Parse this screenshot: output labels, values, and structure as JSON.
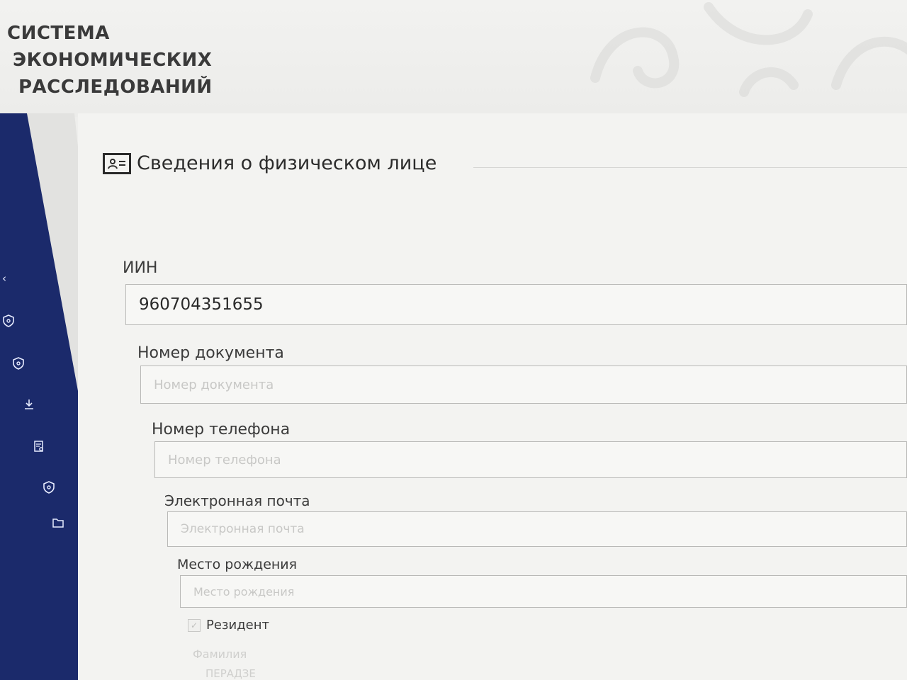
{
  "header": {
    "brand_lines": [
      "СИСТЕМА",
      "ЭКОНОМИЧЕСКИХ",
      "РАССЛЕДОВАНИЙ"
    ]
  },
  "sidebar": {
    "icons": [
      "collapse-icon",
      "shield-icon",
      "shield-icon",
      "download-icon",
      "document-search-icon",
      "shield-icon",
      "folder-icon"
    ]
  },
  "section": {
    "title": "Сведения о физическом лице",
    "icon": "id-card-icon"
  },
  "form": {
    "iin": {
      "label": "ИИН",
      "value": "960704351655"
    },
    "doc_number": {
      "label": "Номер документа",
      "placeholder": "Номер документа"
    },
    "phone": {
      "label": "Номер телефона",
      "placeholder": "Номер телефона"
    },
    "email": {
      "label": "Электронная почта",
      "placeholder": "Электронная почта"
    },
    "birthplace": {
      "label": "Место рождения",
      "placeholder": "Место рождения"
    },
    "resident": {
      "label": "Резидент",
      "checked": true
    },
    "surname": {
      "label": "Фамилия",
      "value": "ПЕРАДЗЕ"
    }
  },
  "colors": {
    "sidebar": "#1b2a6b",
    "background": "#eeeeec",
    "text": "#2c2c2c"
  }
}
